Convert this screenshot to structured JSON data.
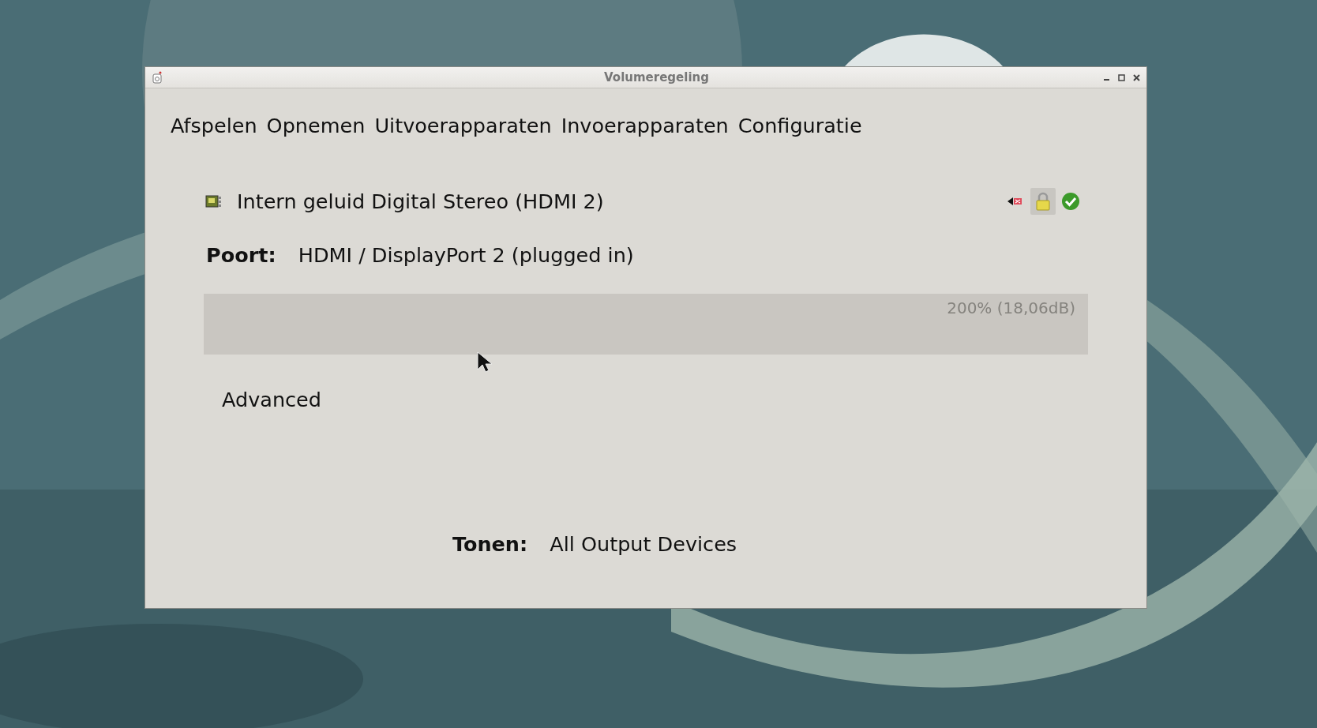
{
  "window": {
    "title": "Volumeregeling"
  },
  "tabs": [
    {
      "label": "Afspelen"
    },
    {
      "label": "Opnemen"
    },
    {
      "label": "Uitvoerapparaten"
    },
    {
      "label": "Invoerapparaten"
    },
    {
      "label": "Configuratie"
    }
  ],
  "device": {
    "name": "Intern geluid Digital Stereo (HDMI 2)",
    "muted": false,
    "locked": true,
    "default": true,
    "port_label": "Poort:",
    "port_value": "HDMI / DisplayPort 2 (plugged in)",
    "volume": {
      "level": 1,
      "reading": "200% (18,06dB)"
    },
    "advanced": "Advanced"
  },
  "filter": {
    "label": "Tonen:",
    "value": "All Output Devices"
  }
}
